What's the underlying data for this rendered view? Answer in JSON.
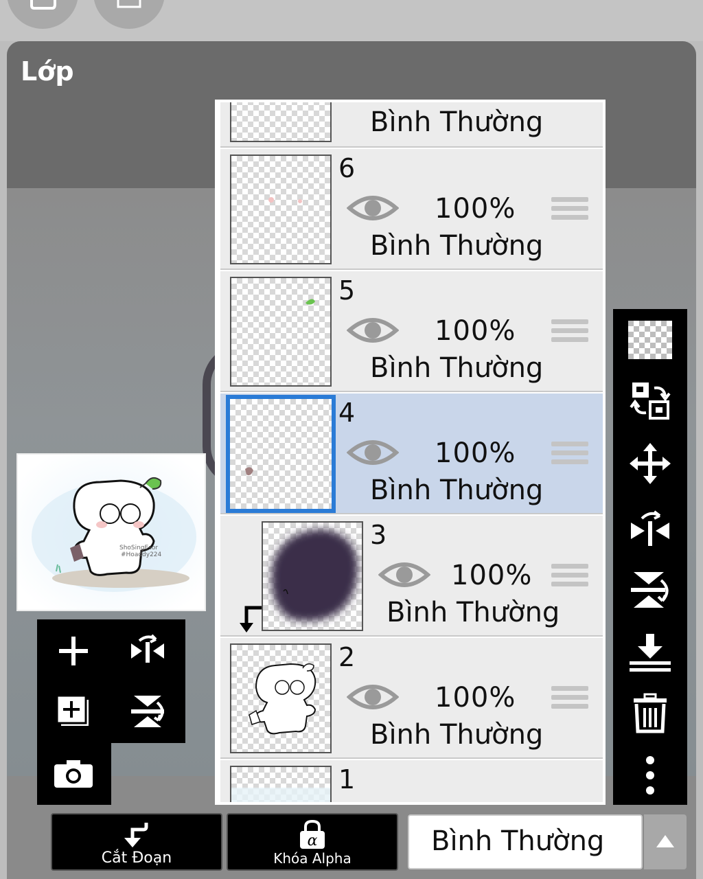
{
  "panel": {
    "title": "Lớp"
  },
  "layers": [
    {
      "number": "",
      "opacity": "",
      "blend_mode": "Bình Thường"
    },
    {
      "number": "6",
      "opacity": "100%",
      "blend_mode": "Bình Thường"
    },
    {
      "number": "5",
      "opacity": "100%",
      "blend_mode": "Bình Thường"
    },
    {
      "number": "4",
      "opacity": "100%",
      "blend_mode": "Bình Thường",
      "selected": true
    },
    {
      "number": "3",
      "opacity": "100%",
      "blend_mode": "Bình Thường",
      "clipped": true
    },
    {
      "number": "2",
      "opacity": "100%",
      "blend_mode": "Bình Thường"
    },
    {
      "number": "1",
      "opacity": "",
      "blend_mode": ""
    }
  ],
  "bottom_bar": {
    "clipping_label": "Cắt Đoạn",
    "alpha_lock_label": "Khóa Alpha",
    "blend_mode_value": "Bình Thường"
  },
  "preview": {
    "watermark": "ShoSingEsor\n#Hoaddy224"
  },
  "icons": {
    "left_tools": [
      "add-layer-icon",
      "flip-horizontal-icon",
      "add-copy-layer-icon",
      "flip-vertical-icon",
      "camera-icon"
    ],
    "right_tools": [
      "transparency-icon",
      "swap-layers-icon",
      "move-icon",
      "flip-horizontal-icon",
      "flip-vertical-icon",
      "merge-down-icon",
      "trash-icon",
      "more-vertical-icon"
    ]
  },
  "colors": {
    "selection_blue": "#2a7bd6",
    "selected_row": "#c9d6ea",
    "row_bg": "#ececec"
  }
}
